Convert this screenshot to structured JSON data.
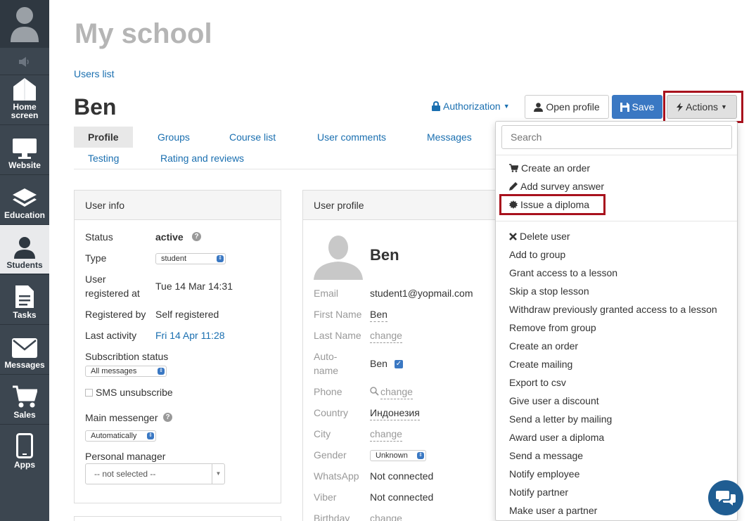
{
  "sidebar": {
    "items": [
      {
        "label": "Home screen",
        "icon": "home-icon"
      },
      {
        "label": "Website",
        "icon": "monitor-icon"
      },
      {
        "label": "Education",
        "icon": "layers-icon"
      },
      {
        "label": "Students",
        "icon": "user-icon"
      },
      {
        "label": "Tasks",
        "icon": "document-icon"
      },
      {
        "label": "Messages",
        "icon": "envelope-icon"
      },
      {
        "label": "Sales",
        "icon": "cart-icon"
      },
      {
        "label": "Apps",
        "icon": "phone-icon"
      }
    ]
  },
  "header": {
    "title": "My school",
    "breadcrumb": "Users list",
    "user_name": "Ben"
  },
  "toolbar": {
    "authorization": "Authorization",
    "open_profile": "Open profile",
    "save": "Save",
    "actions": "Actions"
  },
  "tabs": [
    "Profile",
    "Groups",
    "Course list",
    "User comments",
    "Messages",
    "Testing",
    "Rating and reviews"
  ],
  "user_info": {
    "title": "User info",
    "status_label": "Status",
    "status_value": "active",
    "type_label": "Type",
    "type_value": "student",
    "registered_at_label_1": "User",
    "registered_at_label_2": "registered at",
    "registered_at_value": "Tue 14 Mar 14:31",
    "registered_by_label": "Registered by",
    "registered_by_value": "Self registered",
    "last_activity_label": "Last activity",
    "last_activity_value": "Fri 14 Apr 11:28",
    "subscription_label": "Subscribtion status",
    "subscription_value": "All messages",
    "sms_label": "SMS unsubscribe",
    "messenger_label": "Main messenger",
    "messenger_value": "Automatically",
    "manager_label": "Personal manager",
    "manager_value": "-- not selected --"
  },
  "user_profile": {
    "title": "User profile",
    "name": "Ben",
    "email_label": "Email",
    "email_value": "student1@yopmail.com",
    "first_name_label": "First Name",
    "first_name_value": "Ben",
    "last_name_label": "Last Name",
    "last_name_value": "change",
    "autoname_label_1": "Auto-",
    "autoname_label_2": "name",
    "autoname_value": "Ben",
    "phone_label": "Phone",
    "phone_value": "change",
    "country_label": "Country",
    "country_value": "Индонезия",
    "city_label": "City",
    "city_value": "change",
    "gender_label": "Gender",
    "gender_value": "Unknown",
    "whatsapp_label": "WhatsApp",
    "whatsapp_value": "Not connected",
    "viber_label": "Viber",
    "viber_value": "Not connected",
    "birthday_label": "Birthday",
    "birthday_value": "change"
  },
  "actions_menu": {
    "search_placeholder": "Search",
    "top_items": [
      "Create an order",
      "Add survey answer",
      "Issue a diploma"
    ],
    "items": [
      "Delete user",
      "Add to group",
      "Grant access to a lesson",
      "Skip a stop lesson",
      "Withdraw previously granted access to a lesson",
      "Remove from group",
      "Create an order",
      "Create mailing",
      "Export to csv",
      "Give user a discount",
      "Send a letter by mailing",
      "Award user a diploma",
      "Send a message",
      "Notify employee",
      "Notify partner",
      "Make user a partner"
    ]
  },
  "colors": {
    "sidebar": "#3c4650",
    "link": "#1a6fb0",
    "primary": "#3a78c3",
    "highlight": "#a8111d"
  }
}
